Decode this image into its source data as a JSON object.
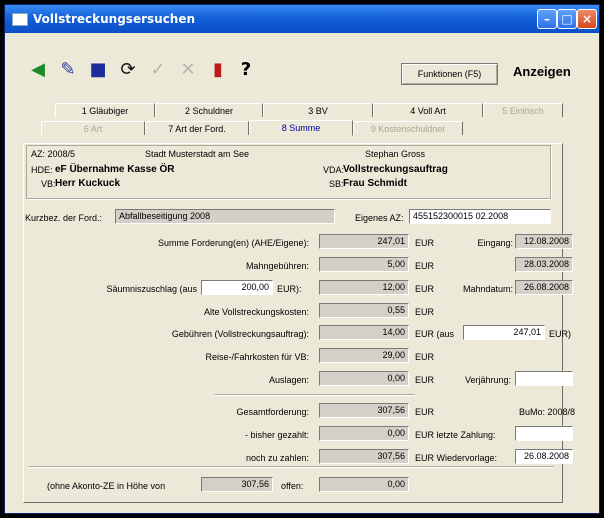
{
  "window": {
    "title": "Vollstreckungsersuchen"
  },
  "toolbar": {
    "icons": [
      "exit-icon",
      "edit-icon",
      "delete-icon",
      "refresh-icon",
      "check-icon",
      "cancel-icon",
      "book-icon",
      "help-icon"
    ],
    "help_glyph": "?",
    "funktionen_label": "Funktionen (F5)",
    "anzeigen_label": "Anzeigen"
  },
  "tabs_row1": [
    "1 Gläubiger",
    "2 Schuldner",
    "3 BV",
    "4 Voll Art",
    "5 Einlösch"
  ],
  "tabs_row2": [
    "6 Art",
    "7 Art der Ford.",
    "8 Summe",
    "9 Kostenschuldner"
  ],
  "header": {
    "az_label": "AZ: 2008/5",
    "stadt": "Stadt Musterstadt am See",
    "person": "Stephan Gross",
    "hde_label": "HDE:",
    "hde_value": "eF Übernahme Kasse ÖR",
    "vb_label": "VB:",
    "vb_value": "Herr Kuckuck",
    "vda_label": "VDA:",
    "vda_value": "Vollstreckungsauftrag",
    "sb_label": "SB:",
    "sb_value": "Frau Schmidt"
  },
  "form": {
    "kurzbez_label": "Kurzbez. der Ford.:",
    "kurzbez_value": "Abfallbeseitigung 2008",
    "eigenes_az_label": "Eigenes AZ:",
    "eigenes_az_value": "455152300015 02.2008",
    "summe_label": "Summe Forderung(en) (AHE/Eigene):",
    "summe_value": "247,01",
    "eingang_label": "Eingang:",
    "eingang_value": "12.08.2008",
    "mahngebuehren_label": "Mahngebühren:",
    "mahngebuehren_value": "5,00",
    "date2_value": "28.03.2008",
    "saeumnis_label": "Säumniszuschlag (aus",
    "saeumnis_base": "200,00",
    "saeumnis_base_suffix": "EUR):",
    "saeumnis_value": "12,00",
    "mahndatum_label": "Mahndatum:",
    "mahndatum_value": "26.08.2008",
    "alte_label": "Alte Vollstreckungskosten:",
    "alte_value": "0,55",
    "gebuehren_label": "Gebühren (Vollstreckungsauftrag):",
    "gebuehren_value": "14,00",
    "gebuehren_aus_label": "EUR (aus",
    "gebuehren_aus_value": "247,01",
    "gebuehren_aus_suffix": "EUR)",
    "reise_label": "Reise-/Fahrkosten für VB:",
    "reise_value": "29,00",
    "auslagen_label": "Auslagen:",
    "auslagen_value": "0,00",
    "verjaehrung_label": "Verjährung:",
    "gesamt_label": "Gesamtforderung:",
    "gesamt_value": "307,56",
    "bumo_label": "BuMo: 2008/8",
    "bisher_label": "- bisher gezahlt:",
    "bisher_value": "0,00",
    "letzte_zahlung_label": "EUR letzte Zahlung:",
    "noch_label": "noch zu zahlen:",
    "noch_value": "307,56",
    "wiedervorlage_label": "EUR Wiedervorlage:",
    "wiedervorlage_value": "26.08.2008",
    "ohne_label": "(ohne Akonto-ZE in Höhe von",
    "ohne_value": "307,56",
    "offen_label": "offen:",
    "offen_value": "0,00",
    "eur": "EUR"
  }
}
